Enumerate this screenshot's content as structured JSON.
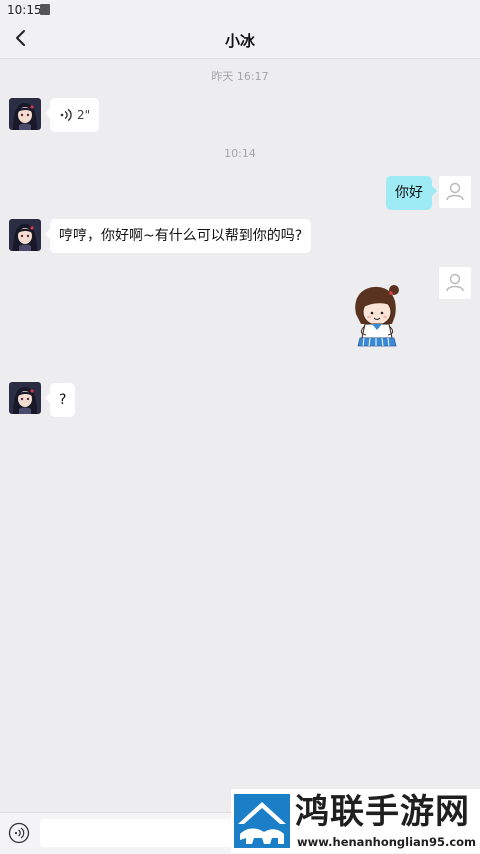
{
  "status_bar": {
    "time": "10:15"
  },
  "header": {
    "title": "小冰",
    "back_icon": "chevron-left-icon"
  },
  "messages": [
    {
      "type": "timestamp",
      "text": "昨天 16:17"
    },
    {
      "type": "voice",
      "sender": "bot",
      "duration": "2\""
    },
    {
      "type": "timestamp",
      "text": "10:14"
    },
    {
      "type": "text",
      "sender": "user",
      "text": "你好"
    },
    {
      "type": "text",
      "sender": "bot",
      "text": "哼哼，你好啊~有什么可以帮到你的吗?"
    },
    {
      "type": "sticker",
      "sender": "user",
      "sticker": "girl-sticker"
    },
    {
      "type": "text",
      "sender": "bot",
      "text": "?"
    }
  ],
  "input_bar": {
    "placeholder": "",
    "voice_icon": "voice-toggle-icon"
  },
  "watermark": {
    "brand": "鸿联手游网",
    "url": "www.henanhonglian95.com"
  },
  "colors": {
    "background": "#ededf0",
    "user_bubble": "#9eebf6",
    "bot_bubble": "#ffffff"
  }
}
